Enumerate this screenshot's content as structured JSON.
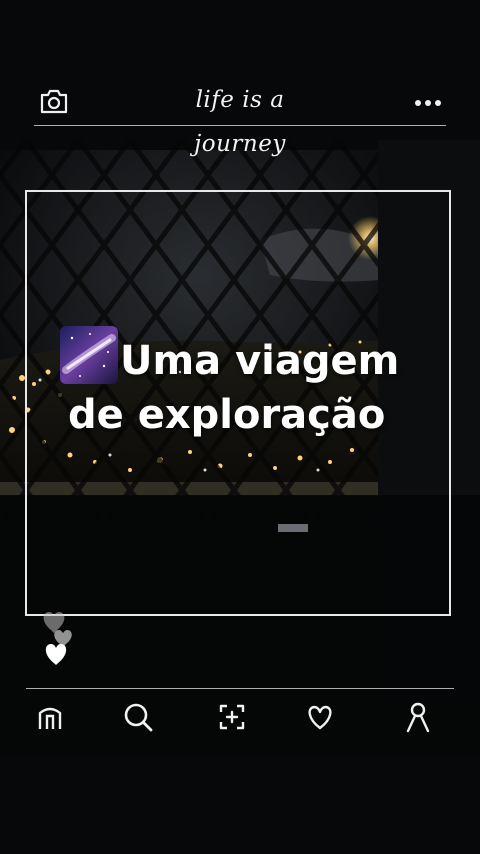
{
  "header": {
    "title": "life is a journey",
    "left_icon": "camera-icon",
    "right_icon": "more-icon"
  },
  "post": {
    "emoji_icon": "milky-way-icon",
    "headline_line1": "Uma viagem",
    "headline_line2": "de exploração"
  },
  "reactions": {
    "icon": "hearts-icon"
  },
  "nav": {
    "items": [
      {
        "icon": "home-icon"
      },
      {
        "icon": "search-icon"
      },
      {
        "icon": "add-post-icon"
      },
      {
        "icon": "heart-icon"
      },
      {
        "icon": "profile-icon"
      }
    ]
  },
  "colors": {
    "background": "#060708",
    "line": "#e8e8e8",
    "text": "#ffffff"
  }
}
